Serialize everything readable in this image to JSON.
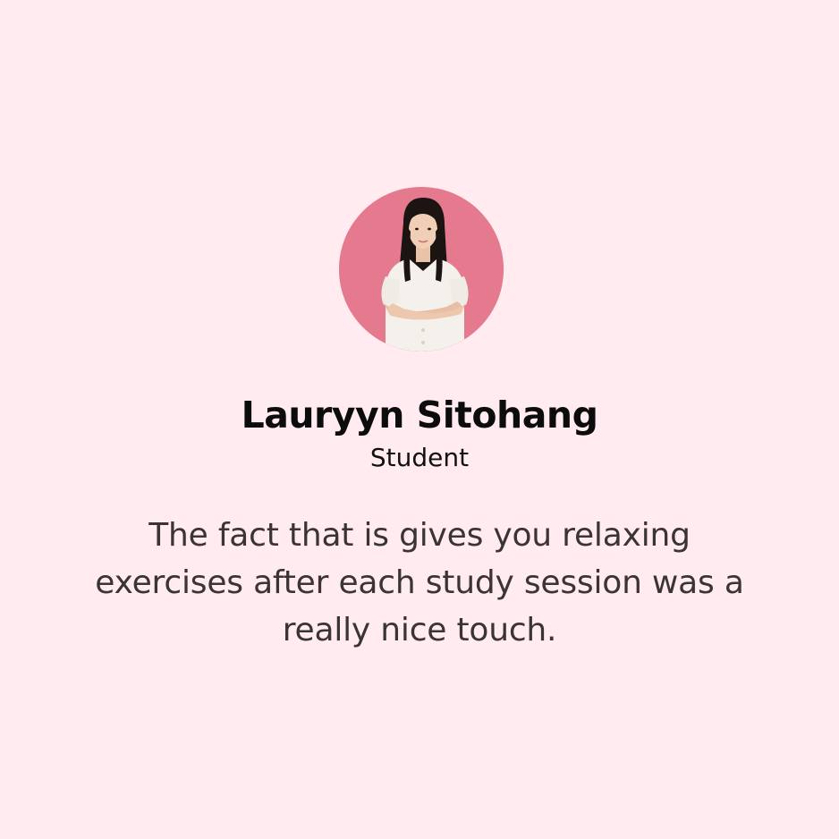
{
  "testimonial": {
    "name": "Lauryyn Sitohang",
    "role": "Student",
    "quote": "The fact that is gives you relaxing exercises after each study session was a really nice touch."
  },
  "colors": {
    "background": "#FFEBF0",
    "avatar_background": "#E57A8E",
    "name_text": "#0C0C0C",
    "quote_text": "#3A3434"
  },
  "icons": {
    "avatar": "person-photo"
  }
}
